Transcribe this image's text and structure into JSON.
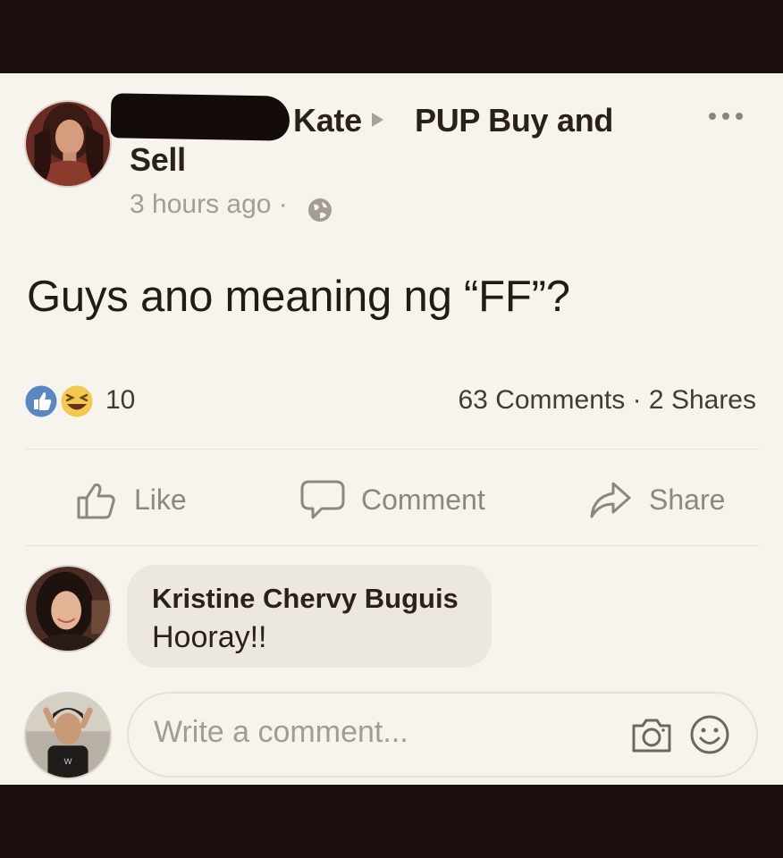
{
  "post": {
    "author_name": "Kate",
    "group_line1": "PUP Buy and",
    "group_line2": "Sell",
    "timestamp": "3 hours ago",
    "separator": "·",
    "privacy_icon": "globe-icon",
    "text": "Guys ano meaning ng “FF”?"
  },
  "stats": {
    "reaction_icons": [
      "like-reaction-icon",
      "haha-reaction-icon"
    ],
    "reaction_count": "10",
    "comments": "63 Comments",
    "dot": "·",
    "shares": "2 Shares"
  },
  "actions": {
    "like": "Like",
    "comment": "Comment",
    "share": "Share"
  },
  "comment": {
    "name": "Kristine Chervy Buguis",
    "text": "Hooray!!"
  },
  "composer": {
    "placeholder": "Write a comment...",
    "camera_icon": "camera-icon",
    "emoji_icon": "emoji-icon"
  },
  "colors": {
    "background": "#f7f4ee",
    "text": "#231b18",
    "muted": "#a49d95",
    "like_blue": "#5a86c2",
    "haha_yellow": "#f2c94c"
  }
}
